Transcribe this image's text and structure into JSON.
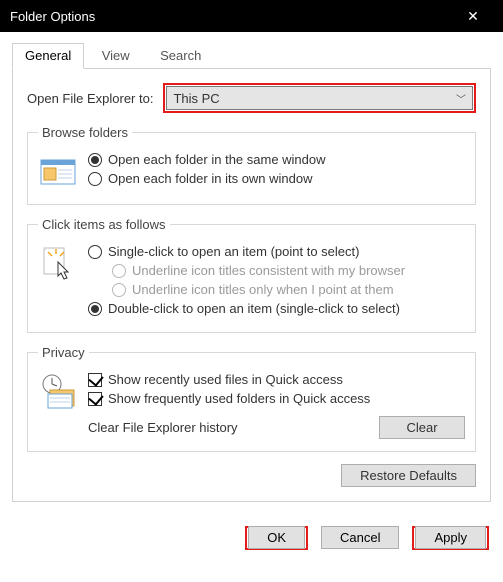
{
  "window": {
    "title": "Folder Options"
  },
  "tabs": {
    "general": "General",
    "view": "View",
    "search": "Search"
  },
  "open_row": {
    "label": "Open File Explorer to:",
    "value": "This PC"
  },
  "browse": {
    "legend": "Browse folders",
    "opt_same": "Open each folder in the same window",
    "opt_own": "Open each folder in its own window"
  },
  "click": {
    "legend": "Click items as follows",
    "single": "Single-click to open an item (point to select)",
    "underline1": "Underline icon titles consistent with my browser",
    "underline2": "Underline icon titles only when I point at them",
    "double": "Double-click to open an item (single-click to select)"
  },
  "privacy": {
    "legend": "Privacy",
    "recent_files": "Show recently used files in Quick access",
    "frequent_folders": "Show frequently used folders in Quick access",
    "clear_label": "Clear File Explorer history",
    "clear_btn": "Clear"
  },
  "buttons": {
    "restore": "Restore Defaults",
    "ok": "OK",
    "cancel": "Cancel",
    "apply": "Apply"
  }
}
